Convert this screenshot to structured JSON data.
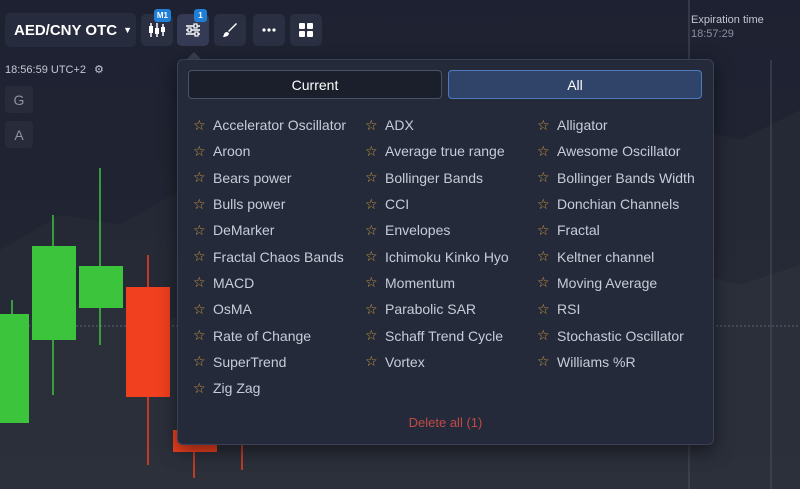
{
  "toolbar": {
    "pair_label": "AED/CNY OTC",
    "chevron_icon": "chevron-down-icon",
    "buttons": [
      {
        "name": "candles-button",
        "icon": "candlestick-icon",
        "badge": "M1"
      },
      {
        "name": "indicators-button",
        "icon": "sliders-icon",
        "badge": "1"
      },
      {
        "name": "drawing-button",
        "icon": "brush-icon",
        "badge": ""
      },
      {
        "name": "more-button",
        "icon": "dots-icon",
        "badge": ""
      },
      {
        "name": "layout-button",
        "icon": "grid-icon",
        "badge": ""
      }
    ]
  },
  "time": {
    "clock": "18:56:59 UTC+2",
    "settings_icon": "gear-icon"
  },
  "side": {
    "g_label": "G",
    "a_label": "A"
  },
  "expiration": {
    "label": "Expiration time",
    "value": "18:57:29"
  },
  "panel": {
    "tabs": {
      "current": "Current",
      "all": "All"
    },
    "star_icon": "star-outline-icon",
    "columns": [
      [
        "Accelerator Oscillator",
        "Aroon",
        "Bears power",
        "Bulls power",
        "DeMarker",
        "Fractal Chaos Bands",
        "MACD",
        "OsMA",
        "Rate of Change",
        "SuperTrend",
        "Zig Zag"
      ],
      [
        "ADX",
        "Average true range",
        "Bollinger Bands",
        "CCI",
        "Envelopes",
        "Ichimoku Kinko Hyo",
        "Momentum",
        "Parabolic SAR",
        "Schaff Trend Cycle",
        "Vortex"
      ],
      [
        "Alligator",
        "Awesome Oscillator",
        "Bollinger Bands Width",
        "Donchian Channels",
        "Fractal",
        "Keltner channel",
        "Moving Average",
        "RSI",
        "Stochastic Oscillator",
        "Williams %R"
      ]
    ],
    "delete_all": "Delete all (1)"
  },
  "colors": {
    "up": "#3cc43c",
    "down": "#f0401f",
    "background": "#1c2030",
    "accent": "#1f7fd6"
  }
}
